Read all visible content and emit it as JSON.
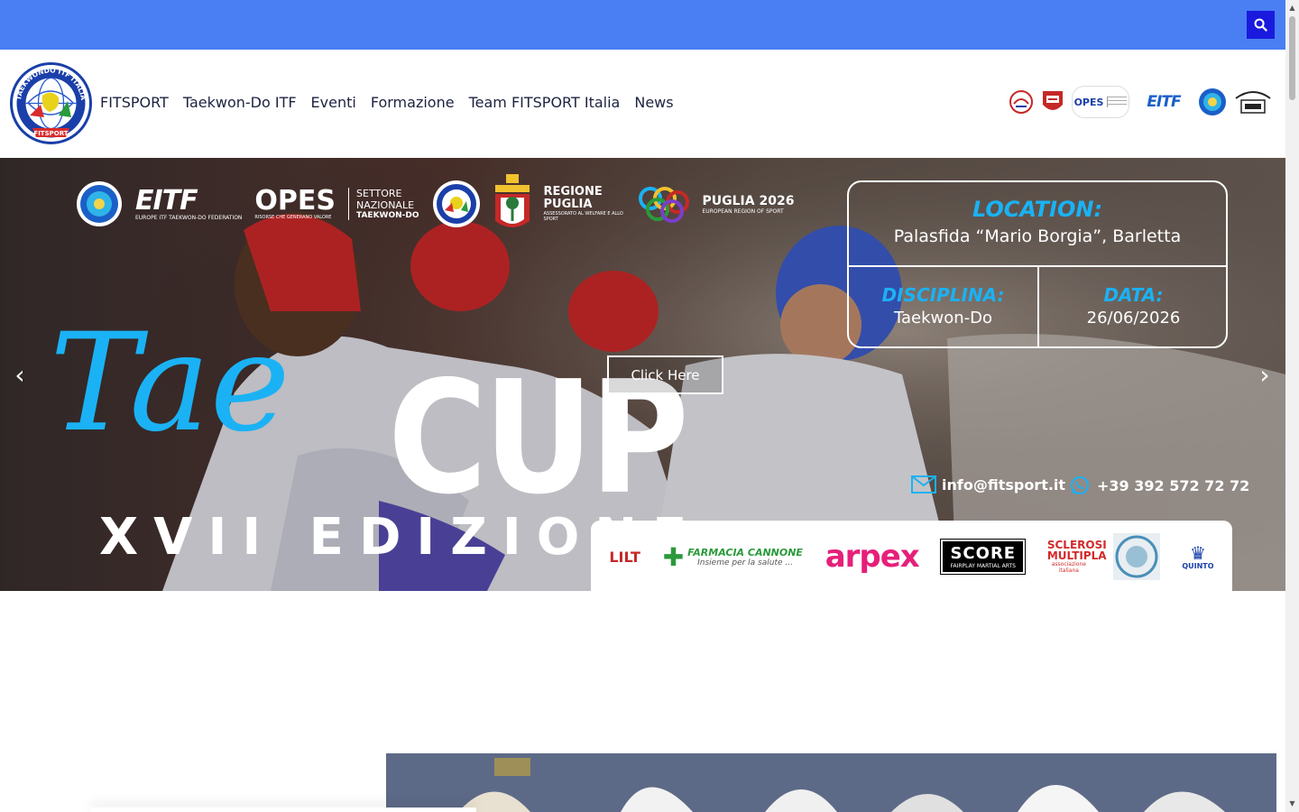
{
  "topbar": {
    "search_icon": "search-icon",
    "accent": "#4a7ff3",
    "search_bg": "#1a1adf"
  },
  "header": {
    "logo_text_top": "TAEKWONDO ITF ITALIA",
    "logo_text_bottom": "FITSPORT",
    "nav": [
      {
        "label": "FITSPORT"
      },
      {
        "label": "Taekwon-Do ITF"
      },
      {
        "label": "Eventi"
      },
      {
        "label": "Formazione"
      },
      {
        "label": "Team FITSPORT Italia"
      },
      {
        "label": "News"
      }
    ],
    "partner_logos": [
      "partner-logo-1",
      "partner-logo-2",
      "partner-logo-opes",
      "partner-logo-eitf",
      "partner-logo-itf",
      "partner-logo-federation"
    ],
    "partner_texts": {
      "opes": "OPES",
      "eitf": "EITF"
    }
  },
  "hero": {
    "title_tae": "Tae",
    "title_cup": "CUP",
    "edition": "XVII EDIZIONE",
    "cta_label": "Click Here",
    "prev_arrow": "‹",
    "next_arrow": "›",
    "org_logos": {
      "eitf": "EITF",
      "eitf_sub": "EUROPE ITF TAEKWON-DO FEDERATION",
      "opes": "OPES",
      "opes_sub": "RISORSE CHE GENERANO VALORE",
      "settore": "SETTORE",
      "nazionale": "NAZIONALE",
      "taekwondo": "TAEKWON-DO",
      "regione": "REGIONE",
      "puglia": "PUGLIA",
      "regione_sub": "ASSESSORATO AL WELFARE E ALLO SPORT",
      "puglia2026": "PUGLIA 2026",
      "puglia2026_sub": "EUROPEAN REGION OF SPORT"
    },
    "info": {
      "location_head": "LOCATION:",
      "location_val": "Palasfida “Mario Borgia”, Barletta",
      "disciplina_head": "DISCIPLINA:",
      "disciplina_val": "Taekwon-Do",
      "data_head": "DATA:",
      "data_val": "26/06/2026"
    },
    "contact": {
      "email": "info@fitsport.it",
      "phone": "+39 392 572 72 72"
    },
    "sponsors": {
      "lilt": "LILT",
      "farmacia": "FARMACIA CANNONE",
      "farmacia_sub": "Insieme per la salute ...",
      "arpex": "arpex",
      "score": "SCORE",
      "score_sub": "FAIRPLAY MARTIAL ARTS",
      "sclerosi": "SCLEROSI MULTIPLA",
      "sclerosi_sub": "associazione italiana",
      "quinto": "QUINTO"
    },
    "colors": {
      "accent_blue": "#1ab2f5",
      "white": "#ffffff"
    }
  }
}
